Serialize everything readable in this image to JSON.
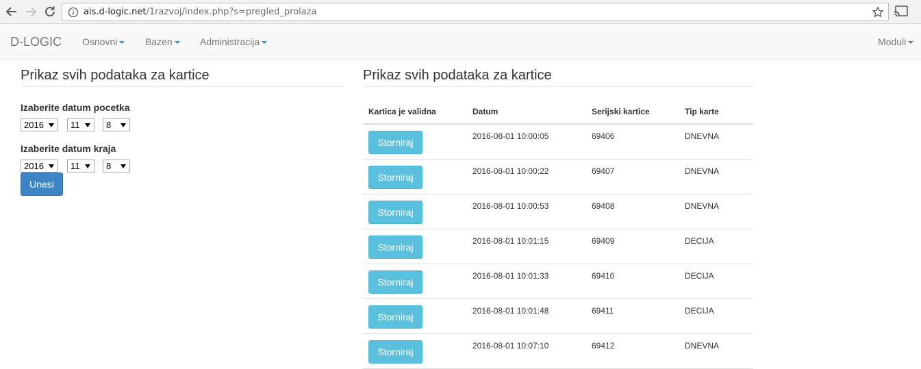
{
  "browser": {
    "url_host": "ais.d-logic.net",
    "url_path": "/1razvoj/index.php?s=pregled_prolaza"
  },
  "navbar": {
    "brand": "D-LOGIC",
    "menu": [
      "Osnovni",
      "Bazen",
      "Administracija"
    ],
    "right_menu": "Moduli"
  },
  "form": {
    "title": "Prikaz svih podataka za kartice",
    "start_label": "Izaberite datum pocetka",
    "start": {
      "year": "2016",
      "month": "11",
      "day": "8"
    },
    "end_label": "Izaberite datum kraja",
    "end": {
      "year": "2016",
      "month": "11",
      "day": "8"
    },
    "submit_label": "Unesi"
  },
  "table": {
    "title": "Prikaz svih podataka za kartice",
    "headers": [
      "Kartica je validna",
      "Datum",
      "Serijski kartice",
      "Tip karte"
    ],
    "action_label": "Storniraj",
    "rows": [
      {
        "datum": "2016-08-01 10:00:05",
        "serial": "69406",
        "tip": "DNEVNA"
      },
      {
        "datum": "2016-08-01 10:00:22",
        "serial": "69407",
        "tip": "DNEVNA"
      },
      {
        "datum": "2016-08-01 10:00:53",
        "serial": "69408",
        "tip": "DNEVNA"
      },
      {
        "datum": "2016-08-01 10:01:15",
        "serial": "69409",
        "tip": "DECIJA"
      },
      {
        "datum": "2016-08-01 10:01:33",
        "serial": "69410",
        "tip": "DECIJA"
      },
      {
        "datum": "2016-08-01 10:01:48",
        "serial": "69411",
        "tip": "DECIJA"
      },
      {
        "datum": "2016-08-01 10:07:10",
        "serial": "69412",
        "tip": "DNEVNA"
      }
    ]
  }
}
